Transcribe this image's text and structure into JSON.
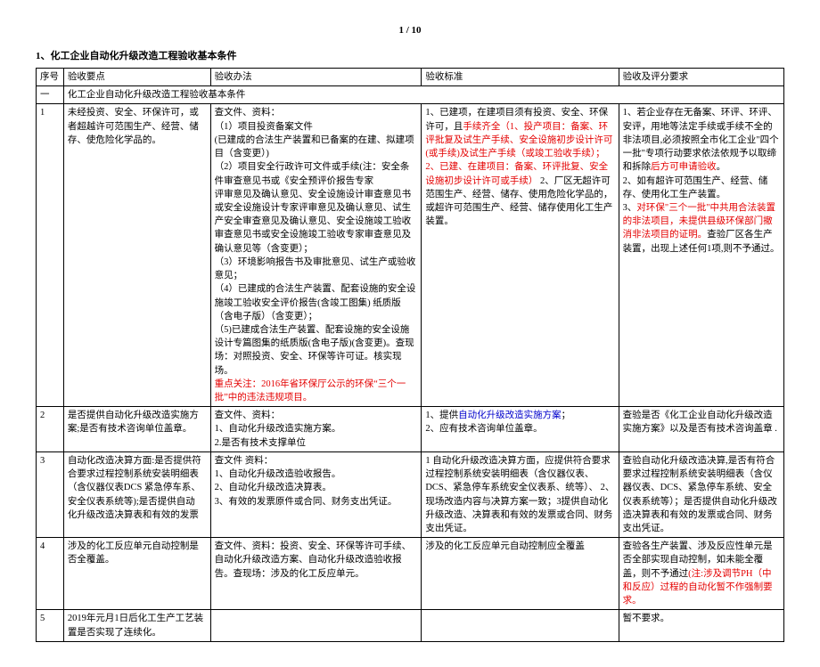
{
  "page_num": "1 / 10",
  "doc_title": "1、化工企业自动化升级改造工程验收基本条件",
  "headers": {
    "c1": "序号",
    "c2": "验收要点",
    "c3": "验收办法",
    "c4": "验收标准",
    "c5": "验收及评分要求"
  },
  "section_row": {
    "num": "一",
    "text": "化工企业自动化升级改造工程验收基本条件"
  },
  "rows": [
    {
      "num": "1",
      "point": "未经投资、安全、环保许可，或者超越许可范围生产、经营、储存、使危险化学品的。",
      "method_parts": [
        {
          "t": "查文件、资料：",
          "c": ""
        },
        {
          "t": "（1）项目投资备案文件",
          "c": ""
        },
        {
          "t": "(已建成的合法生产装置和已备案的在建、拟建项目（含变更）)",
          "c": ""
        },
        {
          "t": "（2）项目安全行政许可文件或手续(注：安全条件审查意见书或《安全预评价报告专家",
          "c": ""
        },
        {
          "t": "评审意见及确认意见、安全设施设计审查意见书或安全设施设计专家评审意见及确认意见、试生产安全审查意见及确认意见、安全设施竣工验收审查意见书或安全设施竣工验收专家审查意见及确认意见等（含变更）；",
          "c": ""
        },
        {
          "t": "（3）环境影响报告书及审批意见、试生产或验收意见；",
          "c": ""
        },
        {
          "t": "（4）已建成的合法生产装置、配套设施的安全设施竣工验收安全评价报告(含竣工图集) 纸质版（含电子版）（含变更）；",
          "c": ""
        },
        {
          "t": "（5)已建成合法生产装置、配套设施的安全设施设计专篇图集的纸质版(含电子版)(含变更)。查现场：对照投资、安全、环保等许可证。核实现场。",
          "c": ""
        },
        {
          "t": "重点关注：2016年省环保厅公示的环保“三个一批”中的违法违规项目。",
          "c": "red"
        }
      ],
      "standard_parts": [
        {
          "t": "1、已建项，在建项目须有投资、安全、环保许可，且",
          "c": ""
        },
        {
          "t": "手续齐全（1、投产项目：备案、环评批复及试生产手续、安全设施初步设计许可(或手续)及试生产手续（或竣工验收手续）；2、已建、在建项目：备案、环评批复、安全设施初步设计许可或手续）",
          "c": "red"
        },
        {
          "t": " 2、厂区无超许可范围生产、经营、储存、使用危险化学品的，或超许可范围生产、经营、储存使用化工生产装置。",
          "c": ""
        }
      ],
      "req_parts": [
        {
          "t": "1、若企业存在无备案、环评、环评、安评，用地等法定手续或手续不全的非法项目,必须按照全市化工企业\"四个一批\"专项行动要求依法依规予以取缔和拆除",
          "c": ""
        },
        {
          "t": "后方可申请验收",
          "c": "red"
        },
        {
          "t": "。",
          "c": ""
        },
        {
          "t": "\n2、如有超许可范围生产、经营、储存、使用化工生产装置。",
          "c": ""
        },
        {
          "t": "\n3、",
          "c": ""
        },
        {
          "t": "对环保\"三个一批\"中共用合法装置的非法项目，未提供县级环保部门撤消非法项目的证明。",
          "c": "red"
        },
        {
          "t": "查验厂区各生产装置，出现上述任何1项,则不予通过。",
          "c": ""
        }
      ]
    },
    {
      "num": "2",
      "point": "是否提供自动化升级改造实施方案;是否有技术咨询单位盖章。",
      "method_parts": [
        {
          "t": "查文件、资料：",
          "c": ""
        },
        {
          "t": "1、自动化升级改造实施方案。",
          "c": ""
        },
        {
          "t": "2.是否有技术支撑单位",
          "c": ""
        }
      ],
      "standard_parts": [
        {
          "t": "1、提供",
          "c": ""
        },
        {
          "t": "自动化升级改造实施方案",
          "c": "blue"
        },
        {
          "t": "；\n2、应有技术咨询单位盖章。",
          "c": ""
        }
      ],
      "req_parts": [
        {
          "t": "查验是否《化工企业自动化升级改造实施方案》以及是否有技术咨询盖章 .",
          "c": ""
        }
      ]
    },
    {
      "num": "3",
      "point": "自动化改造决算方面:是否提供符合要求过程控制系统安装明细表（含仪器仪表DCS 紧急停车系、安全仪表系统等);是否提供自动\n化升级改造决算表和有效的发票",
      "method_parts": [
        {
          "t": "查文件 资料：",
          "c": ""
        },
        {
          "t": "1、自动化升级改造验收报告。",
          "c": ""
        },
        {
          "t": "2、自动化升级改造决算表。",
          "c": ""
        },
        {
          "t": "3、有效的发票原件或合同、财务支出凭证。",
          "c": ""
        }
      ],
      "standard_parts": [
        {
          "t": "1 自动化升级改造决算方面，应提供符合要求过程控制系统安装明细表（含仪器仪表、DCS、紧急停车系统安全仪表系、统等）、 2、现场改造内容与决算方案一致；3提供自动化升级改造、决算表和有效的发票或合同、财务支出凭证。",
          "c": ""
        }
      ],
      "req_parts": [
        {
          "t": "查验自动化升级改造决算,是否有符合要求过程控制系统安装明细表（含仪器仪表、DCS、紧急停车系统、安全仪表系统等）；是否提供自动化升级改造决算表和有效的发票或合同、财务支出凭证。",
          "c": ""
        }
      ]
    },
    {
      "num": "4",
      "point": "涉及的化工反应单元自动控制是否全覆盖。",
      "method_parts": [
        {
          "t": "查文件、资料：投资、安全、环保等许可手续、自动化升级改造方案、自动化升级改造验收报告。查现场：涉及的化工反应单元。",
          "c": ""
        }
      ],
      "standard_parts": [
        {
          "t": "涉及的化工反应单元自动控制应全覆盖",
          "c": ""
        }
      ],
      "req_parts": [
        {
          "t": "查验各生产装置、涉及反应性单元是否全部实现自动控制，如未能全覆盖，则不予通过",
          "c": ""
        },
        {
          "t": "(注:涉及调节PH（中和反应）过程的自动化暂不作强制要求。",
          "c": "red"
        }
      ]
    },
    {
      "num": "5",
      "point": "2019年元月1日后化工生产工艺装置是否实现了连续化。",
      "method_parts": [],
      "standard_parts": [],
      "req_parts": [
        {
          "t": "暂不要求。",
          "c": ""
        }
      ]
    }
  ]
}
